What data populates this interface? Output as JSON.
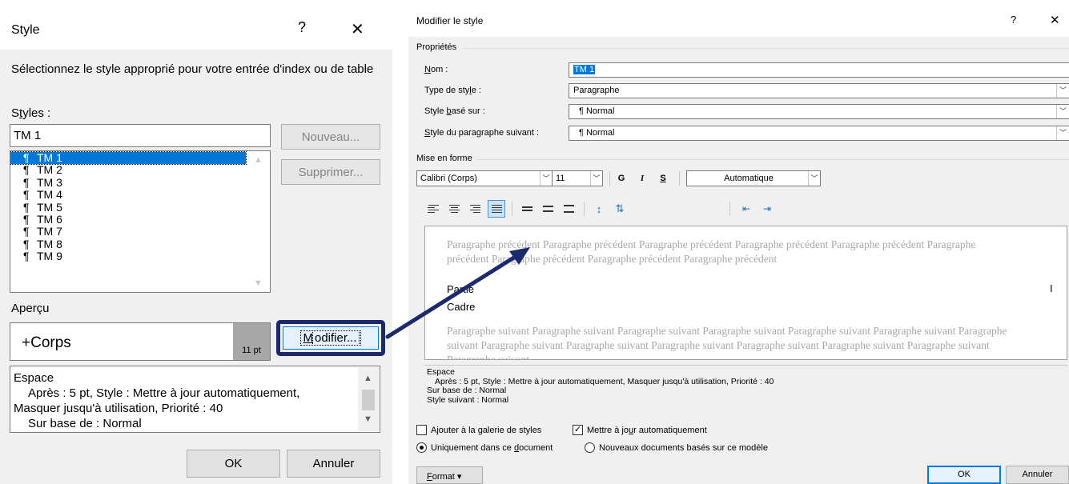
{
  "left_dialog": {
    "title": "Style",
    "help": "?",
    "close": "✕",
    "instruction": "Sélectionnez le style approprié pour votre entrée d'index ou de table",
    "styles_label_pre": "S",
    "styles_label_underlined": "t",
    "styles_label_post": "yles :",
    "style_name_value": "TM 1",
    "style_list": [
      {
        "mark": "¶",
        "name": "TM 1",
        "selected": true
      },
      {
        "mark": "¶",
        "name": "TM 2"
      },
      {
        "mark": "¶",
        "name": "TM 3"
      },
      {
        "mark": "¶",
        "name": "TM 4"
      },
      {
        "mark": "¶",
        "name": "TM 5"
      },
      {
        "mark": "¶",
        "name": "TM 6"
      },
      {
        "mark": "¶",
        "name": "TM 7"
      },
      {
        "mark": "¶",
        "name": "TM 8"
      },
      {
        "mark": "¶",
        "name": "TM 9"
      }
    ],
    "new_button": "Nouveau...",
    "delete_button": "Supprimer...",
    "preview_label": "Aperçu",
    "preview_font": "+Corps",
    "preview_size": "11 pt",
    "modify_button_underlined": "M",
    "modify_button_rest": "odifier...",
    "description": {
      "line1": "Espace",
      "line2": "Après : 5 pt, Style : Mettre à jour automatiquement,",
      "line3": "Masquer jusqu'à utilisation, Priorité : 40",
      "line4": "Sur base de : Normal"
    },
    "ok_button": "OK",
    "cancel_button": "Annuler"
  },
  "right_dialog": {
    "title": "Modifier le style",
    "help": "?",
    "close": "✕",
    "properties_label": "Propriétés",
    "name_label_underlined": "N",
    "name_label_rest": "om :",
    "name_value": "TM 1",
    "type_label_pre": "Type de sty",
    "type_label_underlined": "l",
    "type_label_post": "e :",
    "type_value": "Paragraphe",
    "based_label_pre": "Style ",
    "based_label_underlined": "b",
    "based_label_post": "asé sur :",
    "based_value": "¶  Normal",
    "next_label_underlined": "S",
    "next_label_rest": "tyle du paragraphe suivant :",
    "next_value": "¶  Normal",
    "formatting_label": "Mise en forme",
    "font_value": "Calibri (Corps)",
    "size_value": "11",
    "bold_label": "G",
    "italic_label": "I",
    "underline_label": "S",
    "color_value": "Automatique",
    "preview_prev": "Paragraphe précédent Paragraphe précédent Paragraphe précédent Paragraphe précédent Paragraphe précédent Paragraphe précédent Paragraphe précédent Paragraphe précédent Paragraphe précédent",
    "preview_main_1": "Partie",
    "preview_main_2": "Cadre",
    "preview_cursor": "I",
    "preview_next": "Paragraphe suivant Paragraphe suivant Paragraphe suivant Paragraphe suivant Paragraphe suivant Paragraphe suivant Paragraphe suivant Paragraphe suivant Paragraphe suivant Paragraphe suivant Paragraphe suivant Paragraphe suivant Paragraphe suivant Paragraphe suivant",
    "description": {
      "line1": "Espace",
      "line2": "Après : 5 pt, Style : Mettre à jour automatiquement, Masquer jusqu'à utilisation, Priorité : 40",
      "line3": "Sur base de : Normal",
      "line4": "Style suivant : Normal"
    },
    "add_gallery": "Ajouter à la galerie de styles",
    "auto_update_pre": "Mettre à jo",
    "auto_update_underlined": "u",
    "auto_update_post": "r automatiquement",
    "only_doc_pre": "Uniquement dans ce ",
    "only_doc_underlined": "d",
    "only_doc_post": "ocument",
    "new_docs": "Nouveaux documents basés sur ce modèle",
    "format_button_underlined": "F",
    "format_button_rest": "ormat ▾",
    "ok_button": "OK",
    "cancel_button": "Annuler"
  },
  "colors": {
    "selection": "#0078d7",
    "highlight_frame": "#1a2a6c",
    "dialog_bg": "#f0f0f0"
  }
}
